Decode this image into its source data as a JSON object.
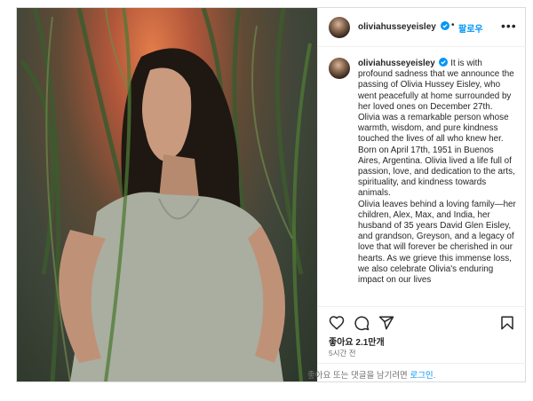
{
  "post": {
    "username": "oliviahusseyeisley",
    "dot": "•",
    "follow_label": "팔로우",
    "more_label": "•••",
    "caption": {
      "username": "oliviahusseyeisley",
      "p1": "It is with profound sadness that we announce the passing of Olivia Hussey Eisley, who went peacefully at home surrounded by her loved ones on December 27th.",
      "p2": "Olivia was a remarkable person whose warmth, wisdom, and pure kindness touched the lives of all who knew her. Born on April 17th, 1951 in Buenos Aires, Argentina. Olivia lived a life full of passion, love, and dedication to the arts, spirituality, and kindness towards animals.",
      "p3": "Olivia leaves behind a loving family—her children, Alex, Max, and India, her husband of 35 years David Glen Eisley, and grandson, Greyson, and a legacy of love that will forever be cherished in our hearts. As we grieve this immense loss, we also celebrate Olivia's enduring impact on our lives"
    },
    "likes": "좋아요 2.1만개",
    "time": "5시간 전",
    "login_prompt": "좋아요 또는 댓글을 남기려면 ",
    "login_link": "로그인",
    "login_suffix": ".",
    "colors": {
      "link": "#0095f6",
      "verified": "#0095f6",
      "text": "#262626",
      "muted": "#737373"
    }
  }
}
